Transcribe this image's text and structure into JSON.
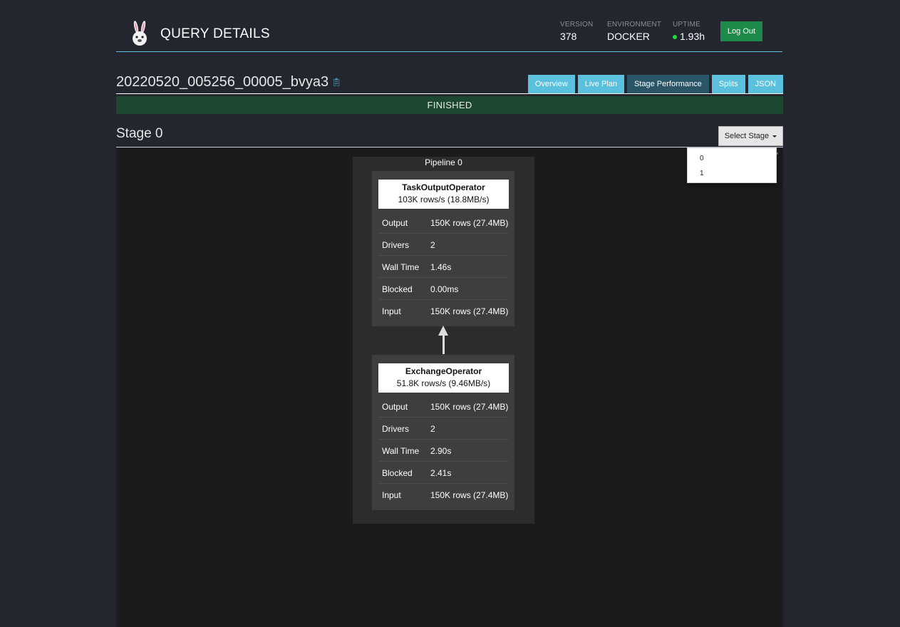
{
  "header": {
    "title": "QUERY DETAILS",
    "version_label": "VERSION",
    "version": "378",
    "environment_label": "ENVIRONMENT",
    "environment": "DOCKER",
    "uptime_label": "UPTIME",
    "uptime": "1.93h",
    "logout_label": "Log Out",
    "uptime_status_color": "#1edc3c"
  },
  "query": {
    "id": "20220520_005256_00005_bvya3",
    "copy_icon": "clipboard-icon",
    "state": "FINISHED"
  },
  "tabs": [
    {
      "label": "Overview",
      "active": false
    },
    {
      "label": "Live Plan",
      "active": false
    },
    {
      "label": "Stage Performance",
      "active": true
    },
    {
      "label": "Splits",
      "active": false
    },
    {
      "label": "JSON",
      "active": false
    }
  ],
  "stage": {
    "title": "Stage 0",
    "select_label": "Select Stage",
    "options": [
      "0",
      "1"
    ]
  },
  "pipeline": {
    "title": "Pipeline 0",
    "operators": [
      {
        "name": "TaskOutputOperator",
        "rate": "103K rows/s (18.8MB/s)",
        "rows": [
          {
            "key": "Output",
            "value": "150K rows (27.4MB)"
          },
          {
            "key": "Drivers",
            "value": "2"
          },
          {
            "key": "Wall Time",
            "value": "1.46s"
          },
          {
            "key": "Blocked",
            "value": "0.00ms"
          },
          {
            "key": "Input",
            "value": "150K rows (27.4MB)"
          }
        ]
      },
      {
        "name": "ExchangeOperator",
        "rate": "51.8K rows/s (9.46MB/s)",
        "rows": [
          {
            "key": "Output",
            "value": "150K rows (27.4MB)"
          },
          {
            "key": "Drivers",
            "value": "2"
          },
          {
            "key": "Wall Time",
            "value": "2.90s"
          },
          {
            "key": "Blocked",
            "value": "2.41s"
          },
          {
            "key": "Input",
            "value": "150K rows (27.4MB)"
          }
        ]
      }
    ]
  },
  "colors": {
    "background": "#23252f",
    "accent": "#5bc0de",
    "finished": "#1b482e",
    "logout": "#1e8a4a"
  }
}
